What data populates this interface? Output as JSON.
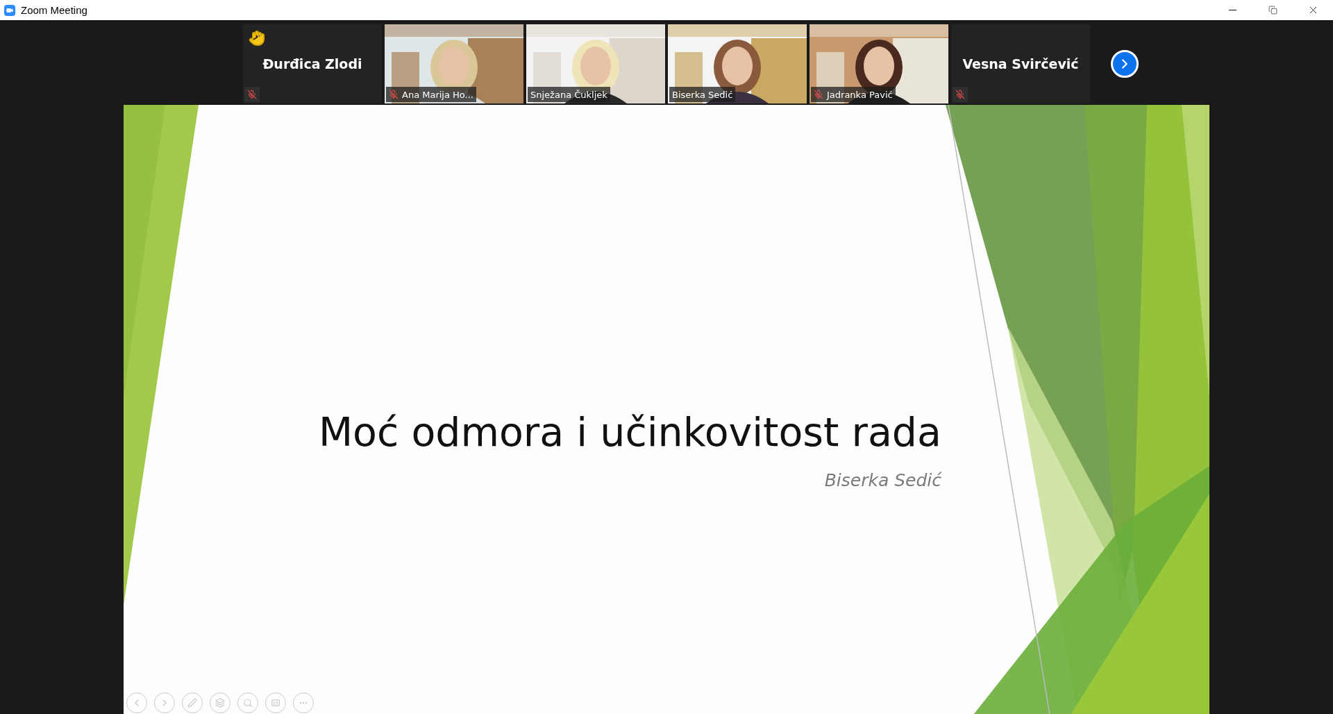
{
  "window": {
    "title": "Zoom Meeting"
  },
  "participants": [
    {
      "kind": "name_only",
      "name": "Đurđica Zlodi",
      "muted": true,
      "raised_hand": true
    },
    {
      "kind": "video",
      "name": "Ana Marija Ho...",
      "muted": true,
      "raised_hand": false
    },
    {
      "kind": "video",
      "name": "Snježana Čukljek",
      "muted": false,
      "raised_hand": false
    },
    {
      "kind": "video",
      "name": "Biserka Sedić",
      "muted": false,
      "raised_hand": false
    },
    {
      "kind": "video",
      "name": "Jadranka Pavić",
      "muted": true,
      "raised_hand": false
    },
    {
      "kind": "name_only",
      "name": "Vesna Svirčević",
      "muted": true,
      "raised_hand": false
    }
  ],
  "slide": {
    "title": "Moć odmora i učinkovitost rada",
    "subtitle": "Biserka Sedić"
  }
}
